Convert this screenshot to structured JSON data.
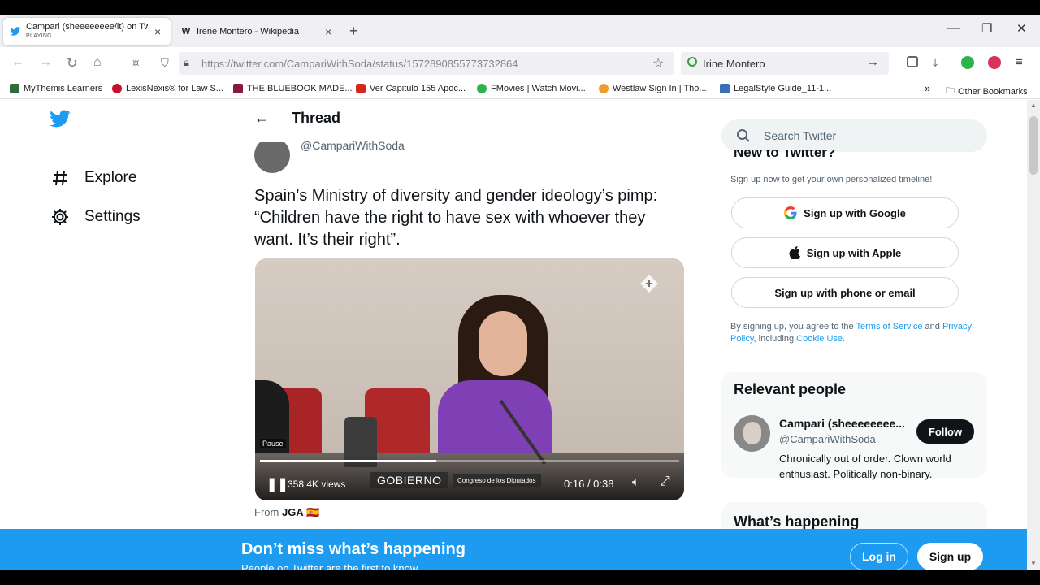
{
  "browser": {
    "tabs": [
      {
        "title": "Campari (sheeeeeeee/it) on Tw",
        "subtitle": "PLAYING",
        "favicon": "twitter-bird-icon"
      },
      {
        "title": "Irene Montero - Wikipedia",
        "favicon": "wikipedia-w-icon",
        "favicon_text": "W"
      }
    ],
    "url": "https://twitter.com/CampariWithSoda/status/1572890855773732864",
    "search_value": "Irine Montero",
    "bookmarks": [
      {
        "label": "MyThemis Learners"
      },
      {
        "label": "LexisNexis® for Law S..."
      },
      {
        "label": "THE BLUEBOOK MADE..."
      },
      {
        "label": "Ver Capitulo 155 Apoc..."
      },
      {
        "label": "FMovies | Watch Movi..."
      },
      {
        "label": "Westlaw Sign In | Tho..."
      },
      {
        "label": "LegalStyle Guide_11-1..."
      }
    ],
    "other_bookmarks": "Other Bookmarks",
    "colors": {
      "tab_bg": "#f0f0f4",
      "accent": "#1d9bf0"
    }
  },
  "twitter": {
    "left_nav": [
      {
        "label": "Explore",
        "icon": "hash-icon"
      },
      {
        "label": "Settings",
        "icon": "gear-icon"
      }
    ],
    "thread_title": "Thread",
    "author_handle": "@CampariWithSoda",
    "tweet_text": "Spain’s Ministry of diversity and gender ideology’s pimp: “Children have the right to have sex with whoever they want. It’s their right”.",
    "video": {
      "pause_tooltip": "Pause",
      "views": "358.4K views",
      "lower_third": "GOBIERNO",
      "lower_third_2": "Congreso de los Diputados",
      "time": "0:16 / 0:38",
      "progress": 0.42
    },
    "from_prefix": "From",
    "from_name": "JGA",
    "from_flag": "🇪🇸",
    "search_placeholder": "Search Twitter",
    "new_to_twitter": "New to Twitter?",
    "signup_sub": "Sign up now to get your own personalized timeline!",
    "signup_google": "Sign up with Google",
    "signup_apple": "Sign up with Apple",
    "signup_phone": "Sign up with phone or email",
    "terms_prefix": "By signing up, you agree to the",
    "terms_link": "Terms of Service",
    "terms_and": "and",
    "privacy_link": "Privacy Policy",
    "terms_including": ", including",
    "cookie_link": "Cookie Use.",
    "relevant_title": "Relevant people",
    "relevant": {
      "name": "Campari (sheeeeeeee...",
      "handle": "@CampariWithSoda",
      "bio": "Chronically out of order. Clown world enthusiast. Politically non-binary.",
      "follow": "Follow"
    },
    "whats_happening": "What’s happening",
    "banner": {
      "headline": "Don’t miss what’s happening",
      "sub": "People on Twitter are the first to know.",
      "login": "Log in",
      "signup": "Sign up"
    }
  }
}
